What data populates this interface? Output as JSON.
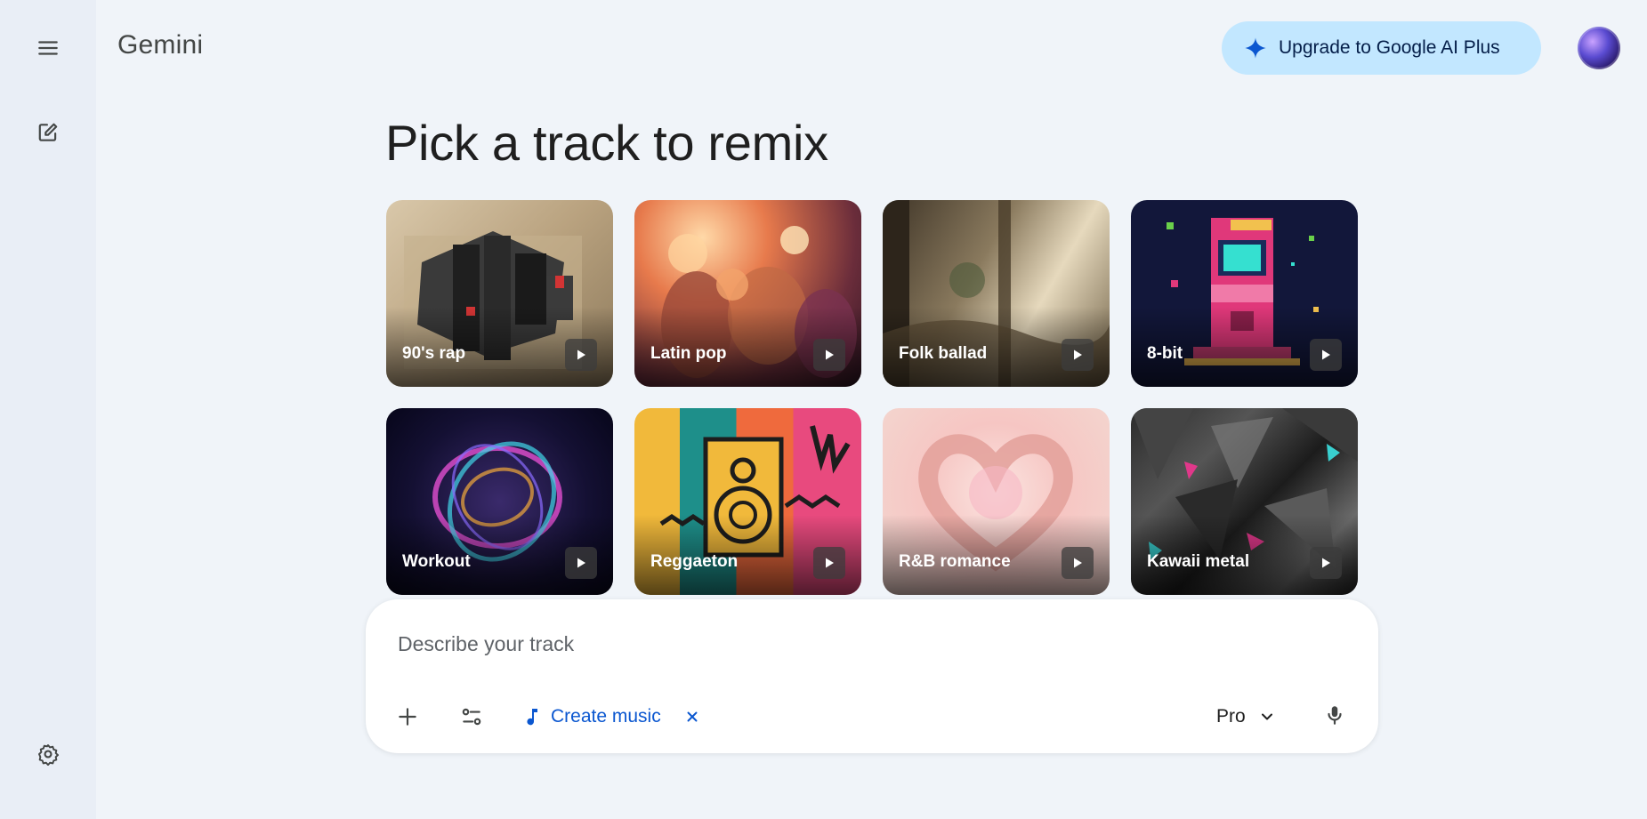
{
  "app": {
    "title": "Gemini"
  },
  "sidebar": {
    "menu_icon": "menu-icon",
    "new_chat_icon": "edit-icon",
    "settings_icon": "gear-icon"
  },
  "header": {
    "upgrade_label": "Upgrade to Google AI Plus",
    "upgrade_icon": "sparkle-icon",
    "avatar_icon": "avatar"
  },
  "main": {
    "heading": "Pick a track to remix",
    "tracks": [
      {
        "label": "90's rap"
      },
      {
        "label": "Latin pop"
      },
      {
        "label": "Folk ballad"
      },
      {
        "label": "8-bit"
      },
      {
        "label": "Workout"
      },
      {
        "label": "Reggaeton"
      },
      {
        "label": "R&B romance"
      },
      {
        "label": "Kawaii metal"
      }
    ]
  },
  "composer": {
    "placeholder": "Describe your track",
    "value": "",
    "tool_label": "Create music",
    "tool_icon": "music-note-icon",
    "model_label": "Pro",
    "add_icon": "plus-icon",
    "tools_icon": "tune-icon",
    "mic_icon": "mic-icon"
  },
  "colors": {
    "background": "#f0f4f9",
    "rail": "#e9eef6",
    "upgrade_bg": "#c2e7ff",
    "accent": "#0b57d0"
  }
}
